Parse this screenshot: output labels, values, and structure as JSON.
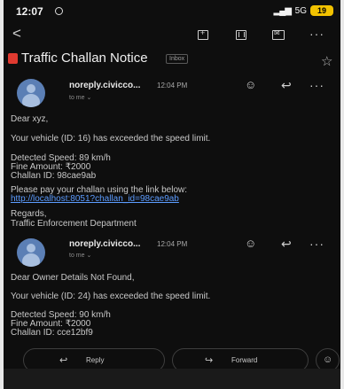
{
  "status_bar": {
    "time": "12:07",
    "network": "5G",
    "battery": "19"
  },
  "toolbar": {
    "back": "<",
    "icons": [
      "add-to-tasks-icon",
      "delete-icon",
      "unread-icon",
      "more-icon"
    ]
  },
  "subject": {
    "title": "Traffic Challan Notice",
    "label": "Inbox",
    "star": "☆"
  },
  "messages": [
    {
      "sender": "noreply.civicco...",
      "time": "12:04 PM",
      "to": "to me",
      "greeting": "Dear xyz,",
      "line1": "Your vehicle (ID: 16) has exceeded the speed limit.",
      "speed": "Detected Speed: 89 km/h",
      "fine": "Fine Amount: ₹2000",
      "challan": "Challan ID: 98cae9ab",
      "pay": "Please pay your challan using the link below:",
      "link": "http://localhost:8051?challan_id=98cae9ab",
      "regards": "Regards,",
      "dept": "Traffic Enforcement Department"
    },
    {
      "sender": "noreply.civicco...",
      "time": "12:04 PM",
      "to": "to me",
      "greeting": "Dear Owner Details Not Found,",
      "line1": "Your vehicle (ID: 24) has exceeded the speed limit.",
      "speed": "Detected Speed: 90 km/h",
      "fine": "Fine Amount: ₹2000",
      "challan": "Challan ID: cce12bf9"
    }
  ],
  "actions": {
    "reply": "Reply",
    "forward": "Forward"
  }
}
